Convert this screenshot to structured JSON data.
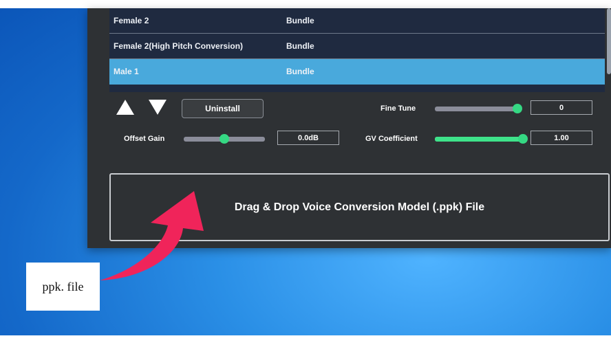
{
  "voice_list": [
    {
      "name": "Female 2",
      "type": "Bundle",
      "selected": false
    },
    {
      "name": "Female 2(High Pitch Conversion)",
      "type": "Bundle",
      "selected": false
    },
    {
      "name": "Male 1",
      "type": "Bundle",
      "selected": true
    }
  ],
  "controls": {
    "move_up_icon": "arrow-up-icon",
    "move_down_icon": "arrow-down-icon",
    "uninstall_label": "Uninstall",
    "offset_gain_label": "Offset Gain",
    "offset_gain_value": "0.0dB",
    "offset_gain_level": 0.5,
    "fine_tune_label": "Fine Tune",
    "fine_tune_value": "0",
    "fine_tune_level": 1.0,
    "gv_coefficient_label": "GV Coefficient",
    "gv_coefficient_value": "1.00",
    "gv_coefficient_level": 1.0
  },
  "dropzone": {
    "text": "Drag & Drop Voice Conversion Model (.ppk) File"
  },
  "annotation": {
    "label": "ppk. file",
    "arrow_color": "#f0245a"
  },
  "colors": {
    "accent": "#3ee28a",
    "selection": "#49a9dc",
    "panel": "#2e3134"
  }
}
